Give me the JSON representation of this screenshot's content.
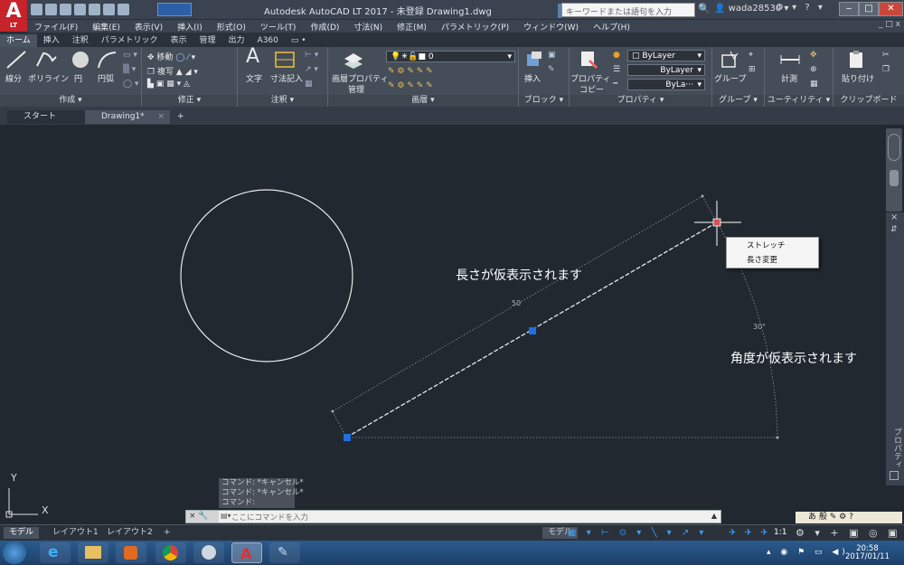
{
  "app": {
    "title": "Autodesk AutoCAD LT 2017 - 未登録    Drawing1.dwg",
    "logo_letter": "A",
    "logo_sub": "LT",
    "search_placeholder": "キーワードまたは語句を入力",
    "user": "wada28530",
    "doc_controls": "_ □ x"
  },
  "menu": [
    "ファイル(F)",
    "編集(E)",
    "表示(V)",
    "挿入(I)",
    "形式(O)",
    "ツール(T)",
    "作成(D)",
    "寸法(N)",
    "修正(M)",
    "パラメトリック(P)",
    "ウィンドウ(W)",
    "ヘルプ(H)"
  ],
  "ribbon_tabs": [
    "ホーム",
    "挿入",
    "注釈",
    "パラメトリック",
    "表示",
    "管理",
    "出力",
    "A360"
  ],
  "ribbon_tab_extra": "▭ •",
  "ribbon": {
    "create": {
      "line": "線分",
      "polyline": "ポリライン",
      "circle": "円",
      "arc": "円弧",
      "title": "作成 ▾"
    },
    "modify": {
      "move": "移動",
      "copy": "複写",
      "title": "修正 ▾"
    },
    "annotation": {
      "text_big": "A",
      "text": "文字",
      "dim": "寸法記入",
      "title": "注釈 ▾"
    },
    "layers": {
      "props": "画層プロパティ",
      "props2": "管理",
      "layer_value": "0",
      "title": "画層 ▾"
    },
    "block": {
      "insert": "挿入",
      "title": "ブロック ▾"
    },
    "properties": {
      "match": "プロパティ",
      "match2": "コピー",
      "bylayer1": "ByLayer",
      "bylayer2": "ByLayer",
      "bylayer3": "ByLa···",
      "title": "プロパティ ▾"
    },
    "groups": {
      "group": "グループ",
      "title": "グループ ▾"
    },
    "utilities": {
      "measure": "計測",
      "title": "ユーティリティ ▾"
    },
    "clipboard": {
      "paste": "貼り付け",
      "title": "クリップボード"
    }
  },
  "file_tabs": {
    "start": "スタート",
    "drawing": "Drawing1*",
    "close": "×",
    "plus": "+"
  },
  "canvas": {
    "annotation_length": "長さが仮表示されます",
    "annotation_angle": "角度が仮表示されます",
    "dim_length": "50",
    "dim_angle": "30°",
    "ucs_y": "Y",
    "ucs_x": "X"
  },
  "context_menu": [
    "ストレッチ",
    "長さ変更"
  ],
  "command": {
    "history": [
      "コマンド: *キャンセル*",
      "コマンド: *キャンセル*",
      "コマンド:"
    ],
    "prefix": "× 🔧",
    "placeholder": "ここにコマンドを入力"
  },
  "layout_tabs": [
    "モデル",
    "レイアウト1",
    "レイアウト2",
    "+"
  ],
  "status": {
    "model": "モデル",
    "scale": "1:1"
  },
  "ime": "あ 般",
  "properties_palette": "プロパティ",
  "clock": {
    "time": "20:58",
    "date": "2017/01/11"
  },
  "colors": {
    "accent": "#1f6fe0",
    "canvas": "#212830",
    "logo": "#c6232b"
  }
}
